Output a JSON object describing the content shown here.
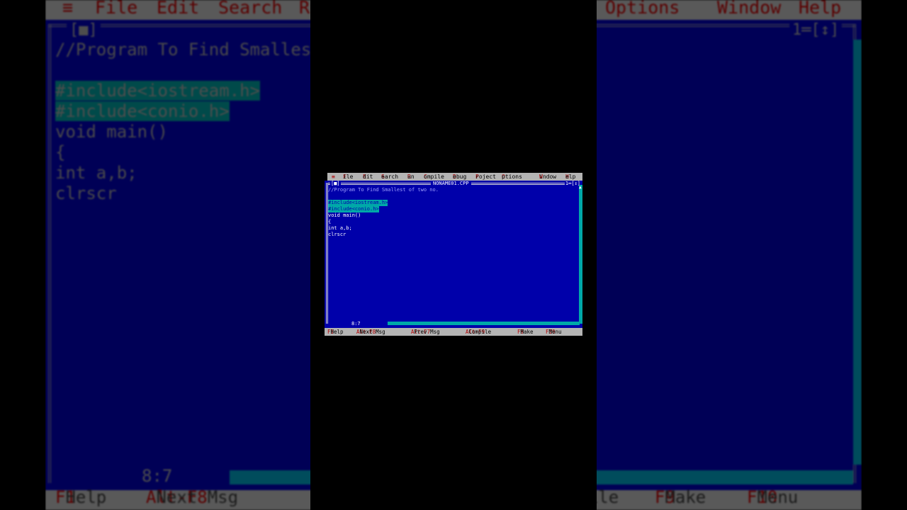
{
  "menu": {
    "system": "≡",
    "items": [
      "File",
      "Edit",
      "Search",
      "Run",
      "Compile",
      "Debug",
      "Project",
      "Options",
      "Window",
      "Help"
    ]
  },
  "window": {
    "close_box": "[■]",
    "title": "NONAME01.CPP",
    "controls": "1═[↕]",
    "cursor_pos": "8:7"
  },
  "code_lines": [
    "//Program To Find Smallest of two no.",
    "",
    "#include<iostream.h>",
    "#include<conio.h>",
    "void main()",
    "{",
    "int a,b;",
    "clrscr"
  ],
  "statusbar": [
    {
      "key": "F1",
      "label": "Help"
    },
    {
      "key": "Alt-F8",
      "label": "Next Msg"
    },
    {
      "key": "Alt-F7",
      "label": "Prev Msg"
    },
    {
      "key": "Alt-F9",
      "label": "Compile"
    },
    {
      "key": "F9",
      "label": "Make"
    },
    {
      "key": "F10",
      "label": "Menu"
    }
  ],
  "colors": {
    "editor_bg": "#0000aa",
    "highlight": "#00a8a8",
    "menu_bg": "#b4b4b4",
    "hotkey": "#b00000"
  }
}
